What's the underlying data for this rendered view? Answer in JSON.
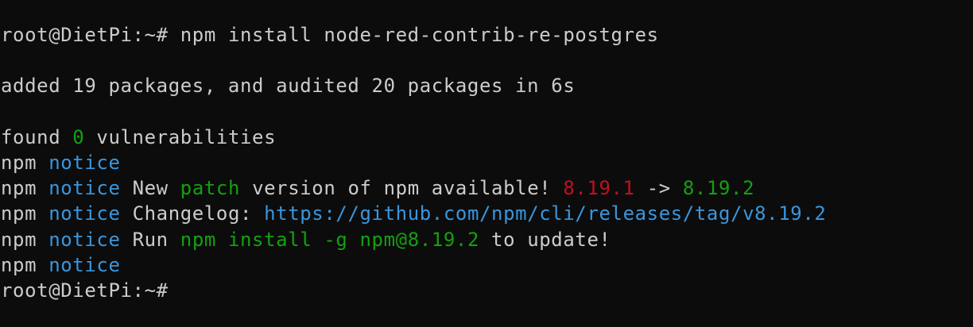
{
  "terminal": {
    "colors": {
      "background": "#0c0c0c",
      "foreground": "#cccccc",
      "blue": "#3a96dd",
      "green": "#13a10e",
      "red": "#c50f1f"
    },
    "lines": {
      "l1": {
        "prompt": "root@DietPi:~#",
        "command": " npm install node-red-contrib-re-postgres"
      },
      "l2": {
        "text": ""
      },
      "l3": {
        "text": "added 19 packages, and audited 20 packages in 6s"
      },
      "l4": {
        "text": ""
      },
      "l5": {
        "a": "found ",
        "count": "0",
        "b": " vulnerabilities"
      },
      "l6": {
        "npm": "npm",
        "notice": " notice"
      },
      "l7": {
        "npm": "npm",
        "notice": " notice",
        "a": " New ",
        "patch": "patch",
        "b": " version of npm available! ",
        "old_version": "8.19.1",
        "arrow": " -> ",
        "new_version": "8.19.2"
      },
      "l8": {
        "npm": "npm",
        "notice": " notice",
        "a": " Changelog: ",
        "url": "https://github.com/npm/cli/releases/tag/v8.19.2"
      },
      "l9": {
        "npm": "npm",
        "notice": " notice",
        "a": " Run ",
        "cmd": "npm install -g npm@8.19.2",
        "b": " to update!"
      },
      "l10": {
        "npm": "npm",
        "notice": " notice"
      },
      "l11": {
        "prompt": "root@DietPi:~#",
        "command": ""
      }
    }
  }
}
